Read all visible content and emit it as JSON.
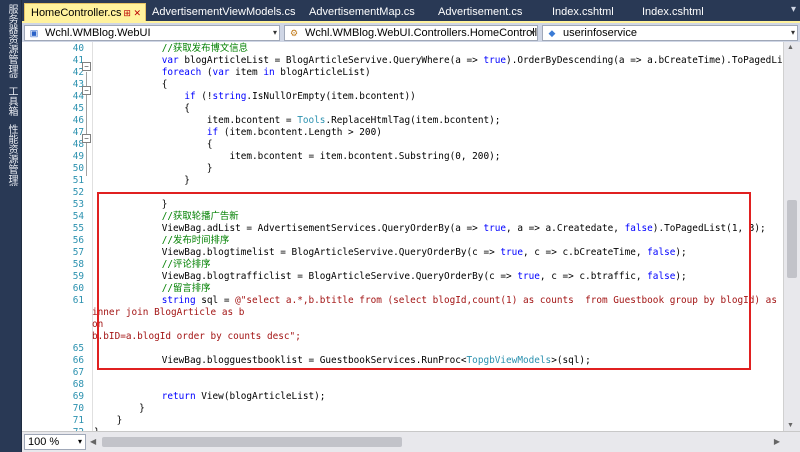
{
  "side_tabs": [
    "服务器资源管理器",
    "工具箱",
    "性能资源管理器"
  ],
  "tabs": [
    {
      "label": "HomeController.cs",
      "active": true
    },
    {
      "label": "AdvertisementViewModels.cs"
    },
    {
      "label": "AdvertisementMap.cs"
    },
    {
      "label": "Advertisement.cs"
    },
    {
      "label": "Index.cshtml"
    },
    {
      "label": "Index.cshtml"
    }
  ],
  "tab_pin_icons": "⊞ ✕",
  "nav": {
    "project": "Wchl.WMBlog.WebUI",
    "class": "Wchl.WMBlog.WebUI.Controllers.HomeController",
    "member": "userinfoservice"
  },
  "zoom_level": "100 %",
  "code_lines": [
    {
      "n": "40",
      "t": "            //获取发布博文信息",
      "c": "cm"
    },
    {
      "n": "41",
      "t": "            var blogArticleList = BlogArticleServive.QueryWhere(a => true).OrderByDescending(a => a.bCreateTime).ToPagedList(pageindex",
      "c": "mixed1"
    },
    {
      "n": "42",
      "t": "            foreach (var item in blogArticleList)",
      "c": "mixed2"
    },
    {
      "n": "43",
      "t": "            {",
      "c": ""
    },
    {
      "n": "44",
      "t": "                if (!string.IsNullOrEmpty(item.bcontent))",
      "c": "mixed3"
    },
    {
      "n": "45",
      "t": "                {",
      "c": ""
    },
    {
      "n": "46",
      "t": "                    item.bcontent = Tools.ReplaceHtmlTag(item.bcontent);",
      "c": "mixed4"
    },
    {
      "n": "47",
      "t": "                    if (item.bcontent.Length > 200)",
      "c": "mixed5"
    },
    {
      "n": "48",
      "t": "                    {",
      "c": ""
    },
    {
      "n": "49",
      "t": "                        item.bcontent = item.bcontent.Substring(0, 200);",
      "c": ""
    },
    {
      "n": "50",
      "t": "                    }",
      "c": ""
    },
    {
      "n": "51",
      "t": "                }",
      "c": ""
    },
    {
      "n": "52",
      "t": "",
      "c": ""
    },
    {
      "n": "53",
      "t": "            }",
      "c": ""
    },
    {
      "n": "54",
      "t": "            //获取轮播广告新",
      "c": "cm"
    },
    {
      "n": "55",
      "t": "            ViewBag.adList = AdvertisementServices.QueryOrderBy(a => true, a => a.Createdate, false).ToPagedList(1, 3);",
      "c": "mixed6"
    },
    {
      "n": "56",
      "t": "            //发布时间排序",
      "c": "cm"
    },
    {
      "n": "57",
      "t": "            ViewBag.blogtimelist = BlogArticleServive.QueryOrderBy(c => true, c => c.bCreateTime, false);",
      "c": "mixed7"
    },
    {
      "n": "58",
      "t": "            //评论排序",
      "c": "cm"
    },
    {
      "n": "59",
      "t": "            ViewBag.blogtrafficlist = BlogArticleServive.QueryOrderBy(c => true, c => c.btraffic, false);",
      "c": "mixed8"
    },
    {
      "n": "60",
      "t": "            //留言排序",
      "c": "cm"
    },
    {
      "n": "61",
      "t": "            string sql = @\"select a.*,b.btitle from (select blogId,count(1) as counts  from Guestbook group by blogId) as a",
      "c": "mixed9"
    },
    {
      "n": "",
      "t": "inner join BlogArticle as b",
      "c": "str",
      "flush": true
    },
    {
      "n": "",
      "t": "on",
      "c": "str",
      "flush": true
    },
    {
      "n": "",
      "t": "b.bID=a.blogId order by counts desc\";",
      "c": "str",
      "flush": true
    },
    {
      "n": "65",
      "t": "",
      "c": ""
    },
    {
      "n": "66",
      "t": "            ViewBag.blogguestbooklist = GuestbookServices.RunProc<TopgbViewModels>(sql);",
      "c": "mixed10"
    },
    {
      "n": "67",
      "t": "",
      "c": ""
    },
    {
      "n": "68",
      "t": "",
      "c": ""
    },
    {
      "n": "69",
      "t": "            return View(blogArticleList);",
      "c": "mixed11"
    },
    {
      "n": "70",
      "t": "        }",
      "c": ""
    },
    {
      "n": "71",
      "t": "    }",
      "c": ""
    },
    {
      "n": "72",
      "t": "}",
      "c": ""
    }
  ],
  "colors": {
    "keyword": "#0000ff",
    "comment": "#008000",
    "string": "#a31515",
    "type": "#2b91af",
    "highlight_box": "#e02020",
    "active_tab": "#fff29d"
  }
}
